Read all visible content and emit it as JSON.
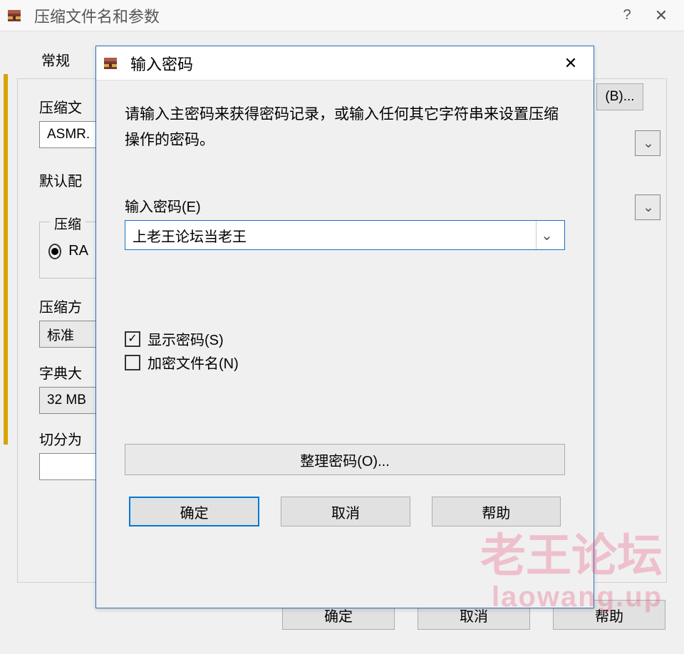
{
  "main": {
    "title": "压缩文件名和参数",
    "tab_general": "常规",
    "filename_label": "压缩文",
    "filename_value": "ASMR.",
    "browse_label": "(B)...",
    "default_cfg_label": "默认配",
    "group_compress_title": "压缩",
    "radio_rar_label": "RA",
    "method_label": "压缩方",
    "method_value": "标准",
    "dict_label": "字典大",
    "dict_value": "32 MB",
    "split_label": "切分为",
    "split_value": "",
    "ok": "确定",
    "cancel": "取消",
    "help": "帮助"
  },
  "modal": {
    "title": "输入密码",
    "description": "请输入主密码来获得密码记录，或输入任何其它字符串来设置压缩操作的密码。",
    "password_label": "输入密码(E)",
    "password_value": "上老王论坛当老王",
    "show_password_label": "显示密码(S)",
    "encrypt_names_label": "加密文件名(N)",
    "organize_label": "整理密码(O)...",
    "ok": "确定",
    "cancel": "取消",
    "help": "帮助"
  },
  "watermark": {
    "line1": "老王论坛",
    "line2": "laowang.up"
  }
}
